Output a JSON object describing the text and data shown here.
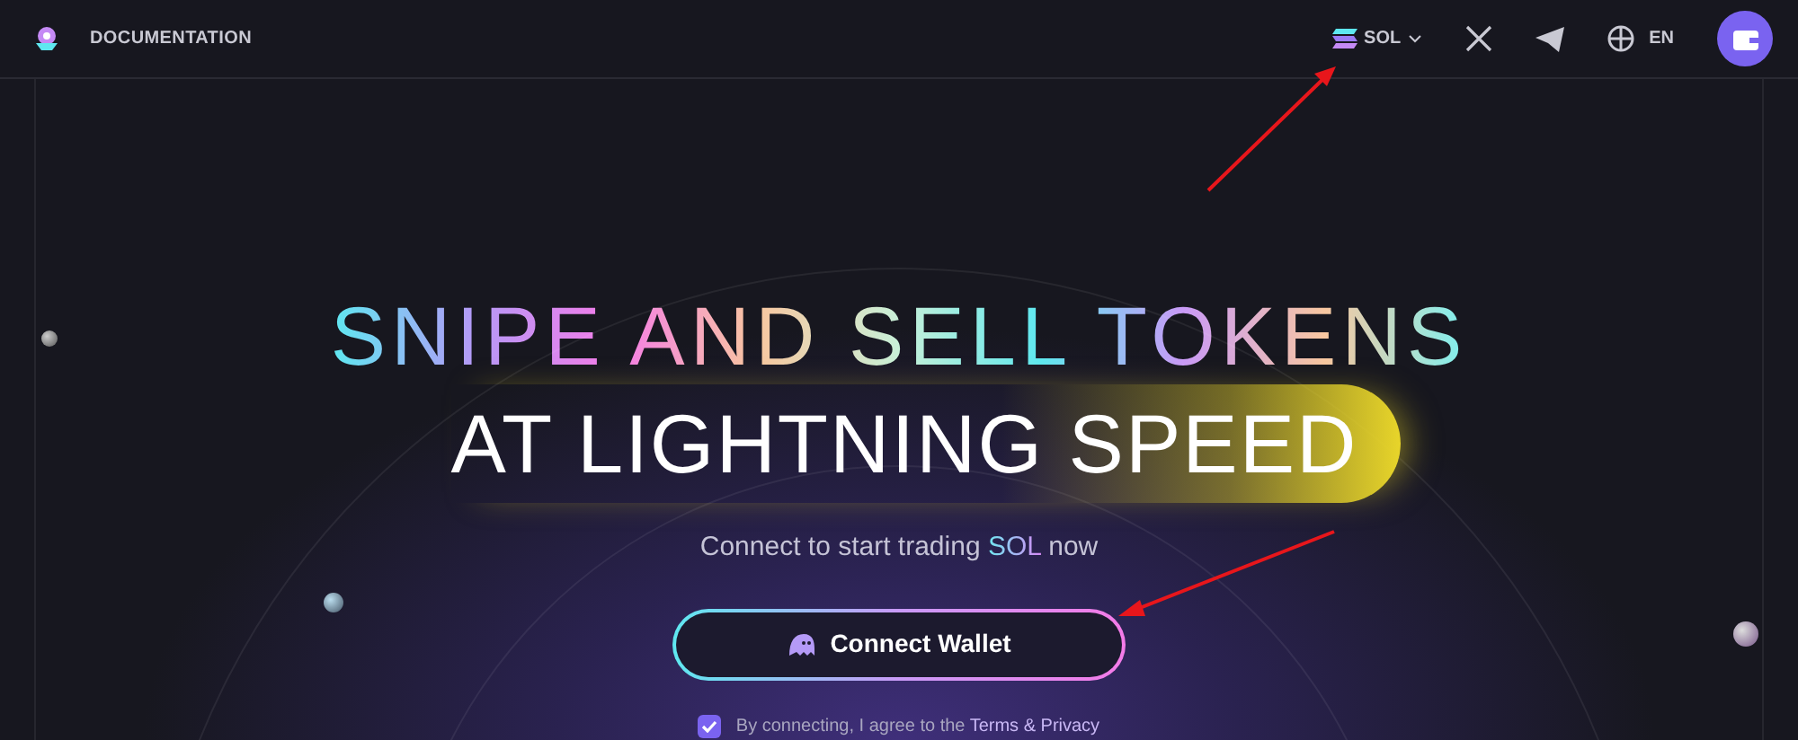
{
  "header": {
    "docs_link": "DOCUMENTATION",
    "network": "SOL",
    "language": "EN"
  },
  "hero": {
    "title_line_1": "SNIPE AND SELL TOKENS",
    "title_line_2": "AT LIGHTNING SPEED",
    "subtitle": [
      {
        "text": "Connect to start trading ",
        "highlight": false
      },
      {
        "text": "SOL",
        "highlight": true
      },
      {
        "text": " now",
        "highlight": false
      }
    ],
    "connect_button": "Connect Wallet",
    "consent": {
      "checked": true,
      "text": "By connecting, I agree to the ",
      "link": "Terms & Privacy"
    }
  }
}
